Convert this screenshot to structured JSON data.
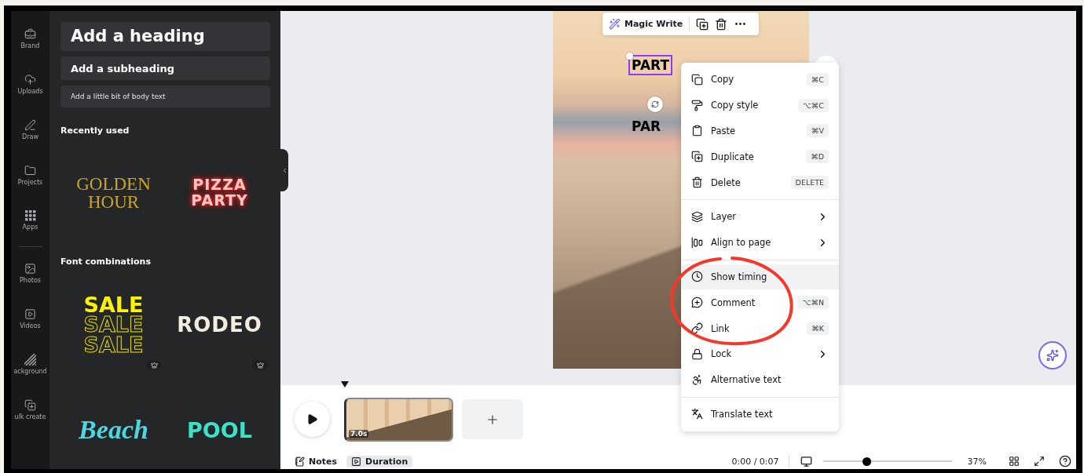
{
  "rail": [
    {
      "label": "Brand"
    },
    {
      "label": "Uploads"
    },
    {
      "label": "Draw"
    },
    {
      "label": "Projects"
    },
    {
      "label": "Apps"
    },
    {
      "label": "Photos"
    },
    {
      "label": "Videos"
    },
    {
      "label": "ackground"
    },
    {
      "label": "ulk create"
    }
  ],
  "panel": {
    "text_styles": [
      {
        "kind": "heading",
        "label": "Add a heading"
      },
      {
        "kind": "subheading",
        "label": "Add a subheading"
      },
      {
        "kind": "body",
        "label": "Add a little bit of body text"
      }
    ],
    "sections": [
      {
        "title": "Recently used",
        "tiles": [
          {
            "kind": "golden",
            "lines": [
              "GOLDEN",
              "HOUR"
            ],
            "premium": false
          },
          {
            "kind": "neon",
            "lines": [
              "PIZZA",
              "PARTY"
            ],
            "premium": false
          }
        ]
      },
      {
        "title": "Font combinations",
        "tiles": [
          {
            "kind": "sale",
            "lines": [
              "SALE",
              "SALE",
              "SALE"
            ],
            "premium": true
          },
          {
            "kind": "rodeo",
            "lines": [
              "RODEO"
            ],
            "premium": true
          },
          {
            "kind": "script",
            "lines": [
              "Beach"
            ],
            "premium": false
          },
          {
            "kind": "pool",
            "lines": [
              "POOL"
            ],
            "premium": false
          }
        ]
      }
    ]
  },
  "toolbar": {
    "label": "Magic Write"
  },
  "canvas": {
    "texts": [
      {
        "label": "PART",
        "selected": true
      },
      {
        "label": "PAR",
        "selected": false
      }
    ]
  },
  "context_menu": {
    "groups": [
      {
        "items": [
          {
            "label": "Copy",
            "shortcut": "⌘C",
            "submenu": false,
            "highlighted": false
          },
          {
            "label": "Copy style",
            "shortcut": "⌥⌘C",
            "submenu": false,
            "highlighted": false
          },
          {
            "label": "Paste",
            "shortcut": "⌘V",
            "submenu": false,
            "highlighted": false
          },
          {
            "label": "Duplicate",
            "shortcut": "⌘D",
            "submenu": false,
            "highlighted": false
          },
          {
            "label": "Delete",
            "shortcut": "DELETE",
            "submenu": false,
            "highlighted": false
          }
        ]
      },
      {
        "items": [
          {
            "label": "Layer",
            "submenu": true,
            "highlighted": false
          },
          {
            "label": "Align to page",
            "submenu": true,
            "highlighted": false
          }
        ]
      },
      {
        "items": [
          {
            "label": "Show timing",
            "submenu": false,
            "highlighted": true
          },
          {
            "label": "Comment",
            "shortcut": "⌥⌘N",
            "submenu": false,
            "highlighted": false
          },
          {
            "label": "Link",
            "shortcut": "⌘K",
            "submenu": false,
            "highlighted": false
          },
          {
            "label": "Lock",
            "submenu": true,
            "highlighted": false
          },
          {
            "label": "Alternative text",
            "submenu": false,
            "highlighted": false
          }
        ]
      },
      {
        "items": [
          {
            "label": "Translate text",
            "submenu": false,
            "highlighted": false
          }
        ]
      }
    ]
  },
  "timeline": {
    "clip_duration": "7.0s"
  },
  "bottom_bar": {
    "notes": "Notes",
    "duration": {
      "label": "Duration",
      "selected": true
    },
    "time": "0:00 / 0:07",
    "zoom": {
      "level": 0.34
    },
    "zoom_reading": "37%"
  }
}
